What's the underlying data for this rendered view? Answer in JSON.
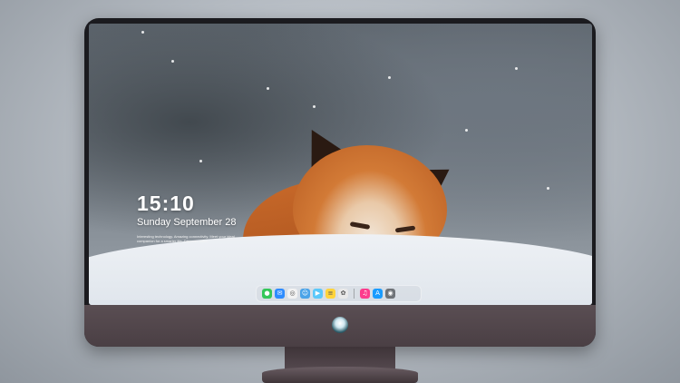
{
  "lock_screen": {
    "time": "15:10",
    "date": "Sunday September 28",
    "tagline": "Interesting technology. Amazing connectivity. Meet your ideal companion for a smarter life. Discover more."
  },
  "wallpaper": {
    "subject": "sleeping fox in snow"
  },
  "dock": {
    "apps": [
      {
        "name": "messages",
        "icon": "messages-icon",
        "color": "#34c759",
        "glyph": "●"
      },
      {
        "name": "mail",
        "icon": "mail-icon",
        "color": "#2e8cff",
        "glyph": "✉"
      },
      {
        "name": "safari",
        "icon": "compass-icon",
        "color": "#f2f2f2",
        "glyph": "◎"
      },
      {
        "name": "finder",
        "icon": "finder-icon",
        "color": "#4aa3e8",
        "glyph": "☺"
      },
      {
        "name": "video",
        "icon": "video-icon",
        "color": "#5ac8fa",
        "glyph": "▶"
      },
      {
        "name": "notes",
        "icon": "notes-icon",
        "color": "#ffd43b",
        "glyph": "≡"
      },
      {
        "name": "photos",
        "icon": "photos-icon",
        "color": "#e9e9e9",
        "glyph": "✿"
      },
      {
        "name": "music",
        "icon": "music-icon",
        "color": "#fc3c8d",
        "glyph": "♫"
      },
      {
        "name": "app-store",
        "icon": "app-store-icon",
        "color": "#1a9cff",
        "glyph": "A"
      },
      {
        "name": "camera",
        "icon": "camera-icon",
        "color": "#6f7378",
        "glyph": "◉"
      }
    ]
  },
  "colors": {
    "bezel": "#1b1b1f",
    "chin": "#4a3f44",
    "text": "#ffffff"
  }
}
